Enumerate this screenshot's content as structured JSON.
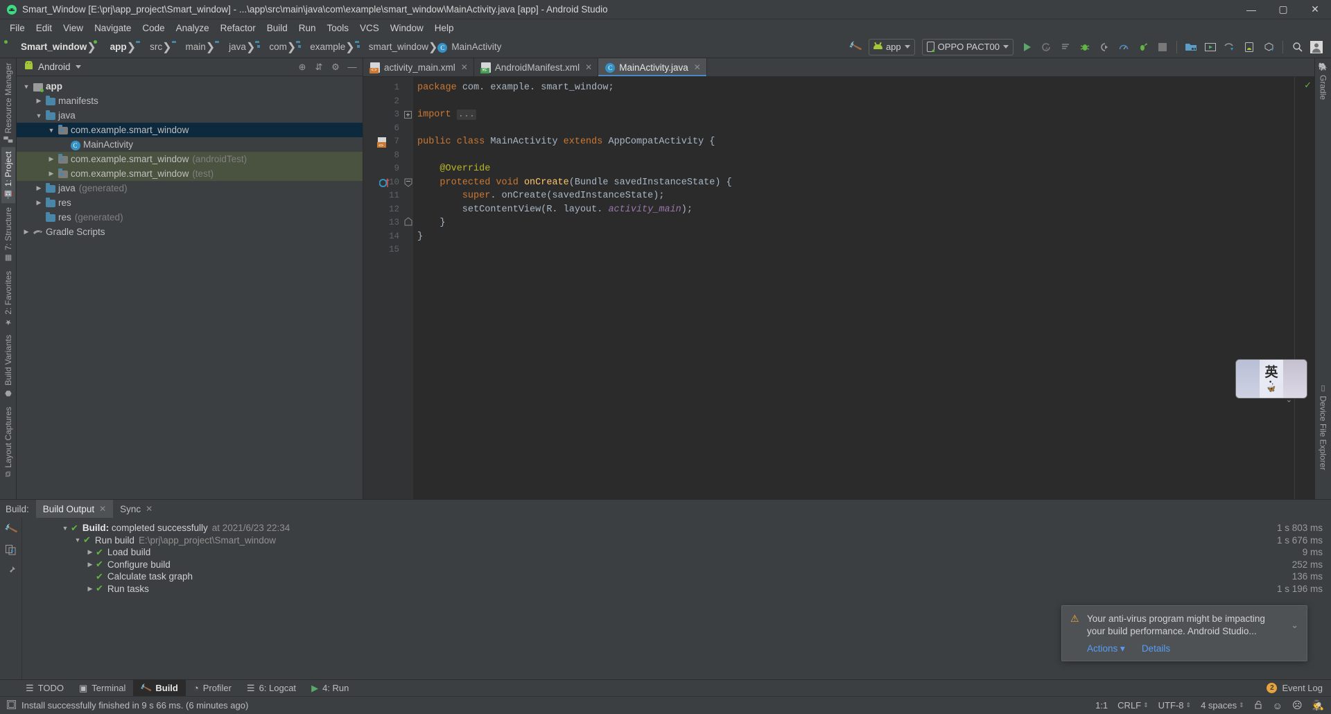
{
  "window": {
    "title": "Smart_Window [E:\\prj\\app_project\\Smart_window] - ...\\app\\src\\main\\java\\com\\example\\smart_window\\MainActivity.java [app] - Android Studio",
    "minimize_label": "—",
    "maximize_label": "▢",
    "close_label": "✕",
    "app_icon": "android-studio-icon"
  },
  "menubar": [
    {
      "label": "File"
    },
    {
      "label": "Edit"
    },
    {
      "label": "View"
    },
    {
      "label": "Navigate"
    },
    {
      "label": "Code"
    },
    {
      "label": "Analyze"
    },
    {
      "label": "Refactor"
    },
    {
      "label": "Build"
    },
    {
      "label": "Run"
    },
    {
      "label": "Tools"
    },
    {
      "label": "VCS"
    },
    {
      "label": "Window"
    },
    {
      "label": "Help"
    }
  ],
  "navbar": {
    "breadcrumbs": [
      {
        "label": "Smart_window",
        "icon": "project-icon",
        "bold": true
      },
      {
        "label": "app",
        "icon": "module-icon",
        "bold": true
      },
      {
        "label": "src",
        "icon": "folder-icon"
      },
      {
        "label": "main",
        "icon": "folder-icon"
      },
      {
        "label": "java",
        "icon": "source-folder-icon"
      },
      {
        "label": "com",
        "icon": "package-icon"
      },
      {
        "label": "example",
        "icon": "package-icon"
      },
      {
        "label": "smart_window",
        "icon": "package-icon"
      },
      {
        "label": "MainActivity",
        "icon": "class-icon"
      }
    ],
    "build_button": "build-hammer-icon",
    "run_config": {
      "label": "app",
      "icon": "android-app-icon"
    },
    "device": {
      "label": "OPPO PACT00",
      "icon": "phone-icon"
    },
    "actions": [
      "run-icon",
      "apply-changes-icon",
      "apply-code-changes-icon",
      "debug-icon",
      "attach-debugger-icon",
      "profiler-icon",
      "run-with-coverage-icon",
      "stop-icon",
      "sdk-manager-icon",
      "avd-manager-icon",
      "layout-inspector-icon",
      "device-manager-icon",
      "sync-gradle-icon",
      "search-icon",
      "avatar-icon"
    ]
  },
  "left_strip": [
    {
      "label": "Resource Manager",
      "icon": "resource-manager-icon",
      "active": false
    },
    {
      "label": "1: Project",
      "icon": "android-icon",
      "active": true
    },
    {
      "label": "7: Structure",
      "icon": "structure-icon",
      "active": false
    },
    {
      "label": "2: Favorites",
      "icon": "star-icon",
      "active": false
    },
    {
      "label": "Build Variants",
      "icon": "variants-icon",
      "active": false
    },
    {
      "label": "Layout Captures",
      "icon": "layout-captures-icon",
      "active": false
    }
  ],
  "right_strip": [
    {
      "label": "Gradle",
      "icon": "gradle-elephant-icon"
    },
    {
      "label": "Device File Explorer",
      "icon": "device-file-explorer-icon"
    }
  ],
  "project_panel": {
    "view_selector": "Android",
    "view_icon": "android-head-icon",
    "actions": [
      "locate-icon",
      "collapse-all-icon",
      "settings-gear-icon",
      "hide-icon"
    ],
    "tree": [
      {
        "label": "app",
        "icon": "module-icon",
        "depth": 0,
        "arrow": "▼",
        "bold": true,
        "state": "normal"
      },
      {
        "label": "manifests",
        "icon": "folder-icon",
        "depth": 1,
        "arrow": "▶",
        "state": "normal"
      },
      {
        "label": "java",
        "icon": "source-folder-icon",
        "depth": 1,
        "arrow": "▼",
        "state": "normal"
      },
      {
        "label": "com.example.smart_window",
        "icon": "package-icon",
        "depth": 2,
        "arrow": "▼",
        "state": "selected"
      },
      {
        "label": "MainActivity",
        "icon": "class-icon",
        "depth": 3,
        "arrow": "",
        "state": "normal"
      },
      {
        "label": "com.example.smart_window",
        "suffix": "(androidTest)",
        "icon": "package-icon",
        "depth": 2,
        "arrow": "▶",
        "state": "test"
      },
      {
        "label": "com.example.smart_window",
        "suffix": "(test)",
        "icon": "package-icon",
        "depth": 2,
        "arrow": "▶",
        "state": "test"
      },
      {
        "label": "java",
        "suffix": "(generated)",
        "icon": "generated-folder-icon",
        "depth": 1,
        "arrow": "▶",
        "state": "normal"
      },
      {
        "label": "res",
        "icon": "res-folder-icon",
        "depth": 1,
        "arrow": "▶",
        "state": "normal"
      },
      {
        "label": "res",
        "suffix": "(generated)",
        "icon": "generated-folder-icon",
        "depth": 1,
        "arrow": "",
        "state": "normal"
      },
      {
        "label": "Gradle Scripts",
        "icon": "gradle-icon",
        "depth": 0,
        "arrow": "▶",
        "state": "normal"
      }
    ]
  },
  "editor": {
    "tabs": [
      {
        "label": "activity_main.xml",
        "icon": "xml-layout-icon",
        "active": false,
        "close": "✕"
      },
      {
        "label": "AndroidManifest.xml",
        "icon": "manifest-xml-icon",
        "active": false,
        "close": "✕"
      },
      {
        "label": "MainActivity.java",
        "icon": "class-icon",
        "active": true,
        "close": "✕"
      }
    ],
    "inspection_status": "✓",
    "lines": [
      {
        "num": "1",
        "marker": "",
        "fold": "",
        "tokens": [
          {
            "t": "package ",
            "c": "kw"
          },
          {
            "t": "com. example. smart_window;",
            "c": "txt"
          }
        ]
      },
      {
        "num": "2",
        "marker": "",
        "fold": "",
        "tokens": []
      },
      {
        "num": "3",
        "marker": "",
        "fold": "+",
        "tokens": [
          {
            "t": "import ",
            "c": "kw"
          },
          {
            "t": "...",
            "c": "fold"
          }
        ]
      },
      {
        "num": "6",
        "marker": "",
        "fold": "",
        "tokens": []
      },
      {
        "num": "7",
        "marker": "layout-gutter-icon",
        "fold": "",
        "tokens": [
          {
            "t": "public class ",
            "c": "kw"
          },
          {
            "t": "MainActivity ",
            "c": "txt"
          },
          {
            "t": "extends ",
            "c": "kw"
          },
          {
            "t": "AppCompatActivity {",
            "c": "txt"
          }
        ]
      },
      {
        "num": "8",
        "marker": "",
        "fold": "",
        "tokens": []
      },
      {
        "num": "9",
        "marker": "",
        "fold": "",
        "tokens": [
          {
            "t": "    @Override",
            "c": "anno"
          }
        ]
      },
      {
        "num": "10",
        "marker": "override-gutter-icon",
        "fold": "−",
        "tokens": [
          {
            "t": "    protected void ",
            "c": "kw"
          },
          {
            "t": "onCreate",
            "c": "mth"
          },
          {
            "t": "(Bundle savedInstanceState) {",
            "c": "txt"
          }
        ]
      },
      {
        "num": "11",
        "marker": "",
        "fold": "",
        "tokens": [
          {
            "t": "        ",
            "c": "txt"
          },
          {
            "t": "super",
            "c": "kw"
          },
          {
            "t": ". onCreate(savedInstanceState);",
            "c": "txt"
          }
        ]
      },
      {
        "num": "12",
        "marker": "",
        "fold": "",
        "tokens": [
          {
            "t": "        setContentView(R. layout. ",
            "c": "txt"
          },
          {
            "t": "activity_main",
            "c": "fld"
          },
          {
            "t": ");",
            "c": "txt"
          }
        ]
      },
      {
        "num": "13",
        "marker": "",
        "fold": "−",
        "tokens": [
          {
            "t": "    }",
            "c": "txt"
          }
        ]
      },
      {
        "num": "14",
        "marker": "",
        "fold": "",
        "tokens": [
          {
            "t": "}",
            "c": "txt"
          }
        ]
      },
      {
        "num": "15",
        "marker": "",
        "fold": "",
        "tokens": []
      }
    ]
  },
  "build_panel": {
    "title": "Build:",
    "tabs": [
      {
        "label": "Build Output",
        "active": true,
        "close": "✕"
      },
      {
        "label": "Sync",
        "active": false,
        "close": "✕"
      }
    ],
    "side_actions": [
      "rerun-build-icon",
      "toggle-tasks-icon",
      "pin-icon"
    ],
    "rows": [
      {
        "arrow": "▼",
        "depth": 0,
        "bold_text": "Build:",
        "text": " completed successfully",
        "dim": "at 2021/6/23 22:34",
        "time": "1 s 803 ms"
      },
      {
        "arrow": "▼",
        "depth": 1,
        "bold_text": "",
        "text": "Run build",
        "dim": "E:\\prj\\app_project\\Smart_window",
        "time": "1 s 676 ms"
      },
      {
        "arrow": "▶",
        "depth": 2,
        "bold_text": "",
        "text": "Load build",
        "dim": "",
        "time": "9 ms"
      },
      {
        "arrow": "▶",
        "depth": 2,
        "bold_text": "",
        "text": "Configure build",
        "dim": "",
        "time": "252 ms"
      },
      {
        "arrow": "",
        "depth": 2,
        "bold_text": "",
        "text": "Calculate task graph",
        "dim": "",
        "time": "136 ms"
      },
      {
        "arrow": "▶",
        "depth": 2,
        "bold_text": "",
        "text": "Run tasks",
        "dim": "",
        "time": "1 s 196 ms"
      }
    ]
  },
  "notification": {
    "icon": "warning-icon",
    "message": "Your anti-virus program might be impacting your build performance. Android Studio...",
    "actions_label": "Actions",
    "details_label": "Details",
    "collapse_icon": "chevron-down-icon"
  },
  "ime_widget": {
    "mode_glyph": "英",
    "sub_glyph": "•,",
    "butterfly_glyph": "🦋"
  },
  "status_tabs": {
    "tabs": [
      {
        "label": "TODO",
        "icon": "todo-icon",
        "active": false
      },
      {
        "label": "Terminal",
        "icon": "terminal-icon",
        "active": false
      },
      {
        "label": "Build",
        "icon": "build-hammer-icon",
        "active": true
      },
      {
        "label": "Profiler",
        "icon": "profiler-icon",
        "active": false
      },
      {
        "label": "6: Logcat",
        "icon": "logcat-icon",
        "active": false
      },
      {
        "label": "4: Run",
        "icon": "run-icon",
        "active": false
      }
    ],
    "event_log": {
      "label": "Event Log",
      "count": "2"
    }
  },
  "statusbar": {
    "message": "Install successfully finished in 9 s 66 ms. (6 minutes ago)",
    "message_icon": "info-icon",
    "caret": "1:1",
    "line_separator": "CRLF",
    "encoding": "UTF-8",
    "indent": "4 spaces",
    "lock_icon": "unlocked-icon",
    "faces": [
      "happy-face-icon",
      "sad-face-icon",
      "hat-face-icon"
    ]
  },
  "colors": {
    "accent": "#4a88c7",
    "success": "#62b543",
    "warning": "#f0a732",
    "selection": "#0d293e",
    "test_source": "#4a5240",
    "link": "#589df6"
  }
}
